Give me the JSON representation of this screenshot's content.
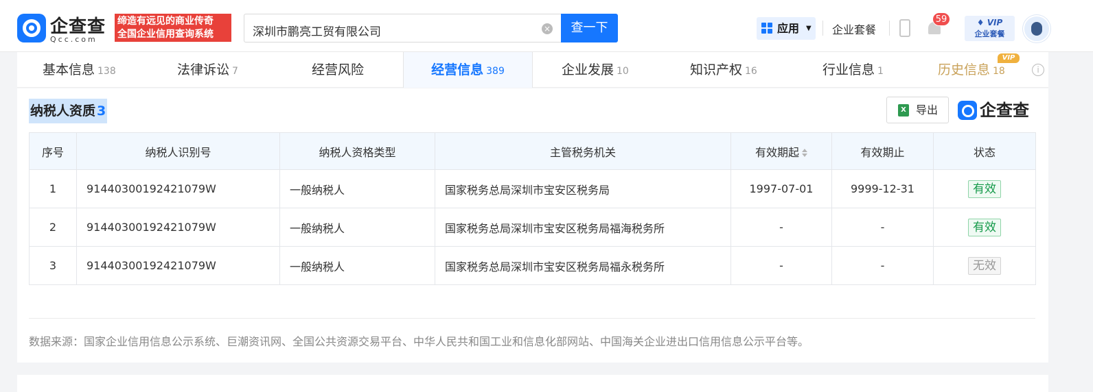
{
  "header": {
    "logo_text": "企查查",
    "logo_sub": "Qcc.com",
    "slogan_line1": "缔造有远见的商业传奇",
    "slogan_line2": "全国企业信用查询系统",
    "search_value": "深圳市鹏亮工贸有限公司",
    "search_button": "查一下",
    "app_button": "应用",
    "package_link": "企业套餐",
    "notification_count": "59",
    "vip_line1": "VIP",
    "vip_line2": "企业套餐",
    "accent_color": "#1677ff"
  },
  "tabs": [
    {
      "label": "基本信息",
      "count": "138"
    },
    {
      "label": "法律诉讼",
      "count": "7"
    },
    {
      "label": "经营风险",
      "count": ""
    },
    {
      "label": "经营信息",
      "count": "389"
    },
    {
      "label": "企业发展",
      "count": "10"
    },
    {
      "label": "知识产权",
      "count": "16"
    },
    {
      "label": "行业信息",
      "count": "1"
    },
    {
      "label": "历史信息",
      "count": "18"
    }
  ],
  "history_vip_tag": "VIP",
  "section": {
    "title": "纳税人资质",
    "count": "3",
    "export_label": "导出",
    "watermark_logo": "企查查"
  },
  "table": {
    "columns": [
      "序号",
      "纳税人识别号",
      "纳税人资格类型",
      "主管税务机关",
      "有效期起",
      "有效期止",
      "状态"
    ],
    "rows": [
      {
        "no": "1",
        "tax_id": "91440300192421079W",
        "type": "一般纳税人",
        "authority": "国家税务总局深圳市宝安区税务局",
        "start": "1997-07-01",
        "end": "9999-12-31",
        "status": "有效"
      },
      {
        "no": "2",
        "tax_id": "91440300192421079W",
        "type": "一般纳税人",
        "authority": "国家税务总局深圳市宝安区税务局福海税务所",
        "start": "-",
        "end": "-",
        "status": "有效"
      },
      {
        "no": "3",
        "tax_id": "91440300192421079W",
        "type": "一般纳税人",
        "authority": "国家税务总局深圳市宝安区税务局福永税务所",
        "start": "-",
        "end": "-",
        "status": "无效"
      }
    ]
  },
  "source_text": "数据来源：国家企业信用信息公示系统、巨潮资讯网、全国公共资源交易平台、中华人民共和国工业和信息化部网站、中国海关企业进出口信用信息公示平台等。"
}
